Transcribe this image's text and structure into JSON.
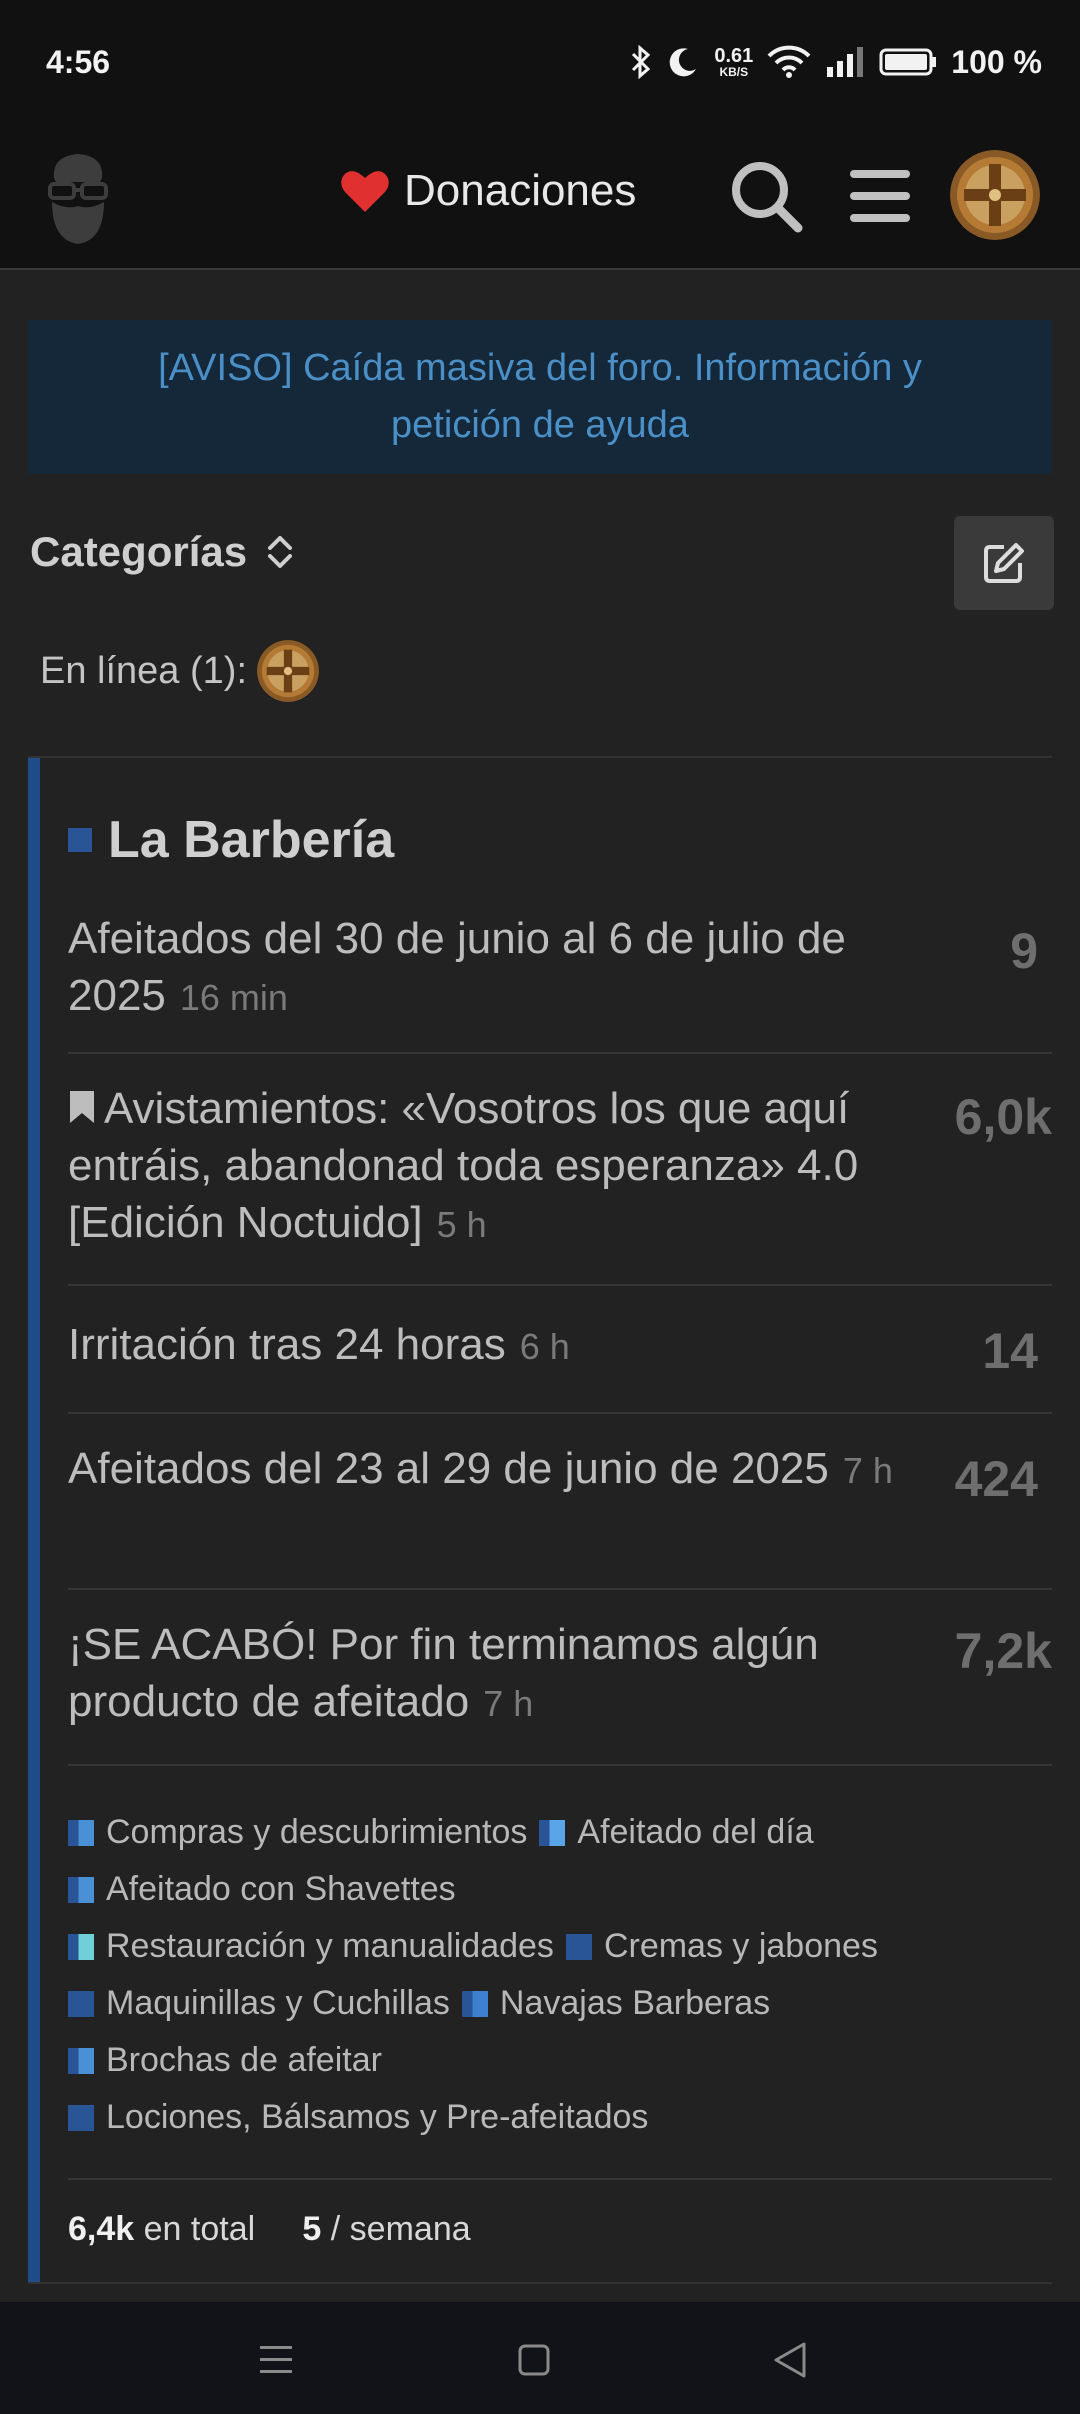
{
  "status_bar": {
    "time": "4:56",
    "net_speed_value": "0.61",
    "net_speed_unit": "KB/S",
    "battery": "100 %"
  },
  "header": {
    "donate_label": "Donaciones",
    "logo_icon": "bearded-man-logo-icon",
    "search_icon": "search-icon",
    "menu_icon": "hamburger-menu-icon"
  },
  "notice": {
    "text": "[AVISO] Caída masiva del foro. Información y petición de ayuda"
  },
  "categories": {
    "title": "Categorías"
  },
  "online": {
    "label": "En línea (1):"
  },
  "category": {
    "name": "La Barbería",
    "color": "#295495",
    "topics": [
      {
        "title": "Afeitados del 30 de junio al 6 de julio de 2025",
        "age": "16 min",
        "count": "9",
        "bookmarked": false
      },
      {
        "title": "Avistamientos: «Vosotros los que aquí entráis, abandonad toda esperanza» 4.0 [Edición Noctuido]",
        "age": "5 h",
        "count": "6,0k",
        "bookmarked": true
      },
      {
        "title": "Irritación tras 24 horas",
        "age": "6 h",
        "count": "14",
        "bookmarked": false
      },
      {
        "title": "Afeitados del 23 al 29 de junio de 2025",
        "age": "7 h",
        "count": "424",
        "bookmarked": false
      },
      {
        "title": "¡SE ACABÓ! Por fin terminamos algún producto de afeitado",
        "age": "7 h",
        "count": "7,2k",
        "bookmarked": false
      }
    ],
    "subcategories": [
      {
        "label": "Compras y descubrimientos",
        "color": "#4a90d6"
      },
      {
        "label": "Afeitado del día",
        "color": "#5aa5e8"
      },
      {
        "label": "Afeitado con Shavettes",
        "color": "#4a90d6"
      },
      {
        "label": "Restauración y manualidades",
        "color": "#6fd0d8"
      },
      {
        "label": "Cremas y jabones",
        "color": "#295495"
      },
      {
        "label": "Maquinillas y Cuchillas",
        "color": "#295495"
      },
      {
        "label": "Navajas Barberas",
        "color": "#3f7fd0"
      },
      {
        "label": "Brochas de afeitar",
        "color": "#4a90d6"
      },
      {
        "label": "Lociones, Bálsamos y Pre-afeitados",
        "color": "#295495"
      }
    ],
    "stats": {
      "total_value": "6,4k",
      "total_label": "en total",
      "week_value": "5",
      "week_label": "/ semana"
    }
  }
}
